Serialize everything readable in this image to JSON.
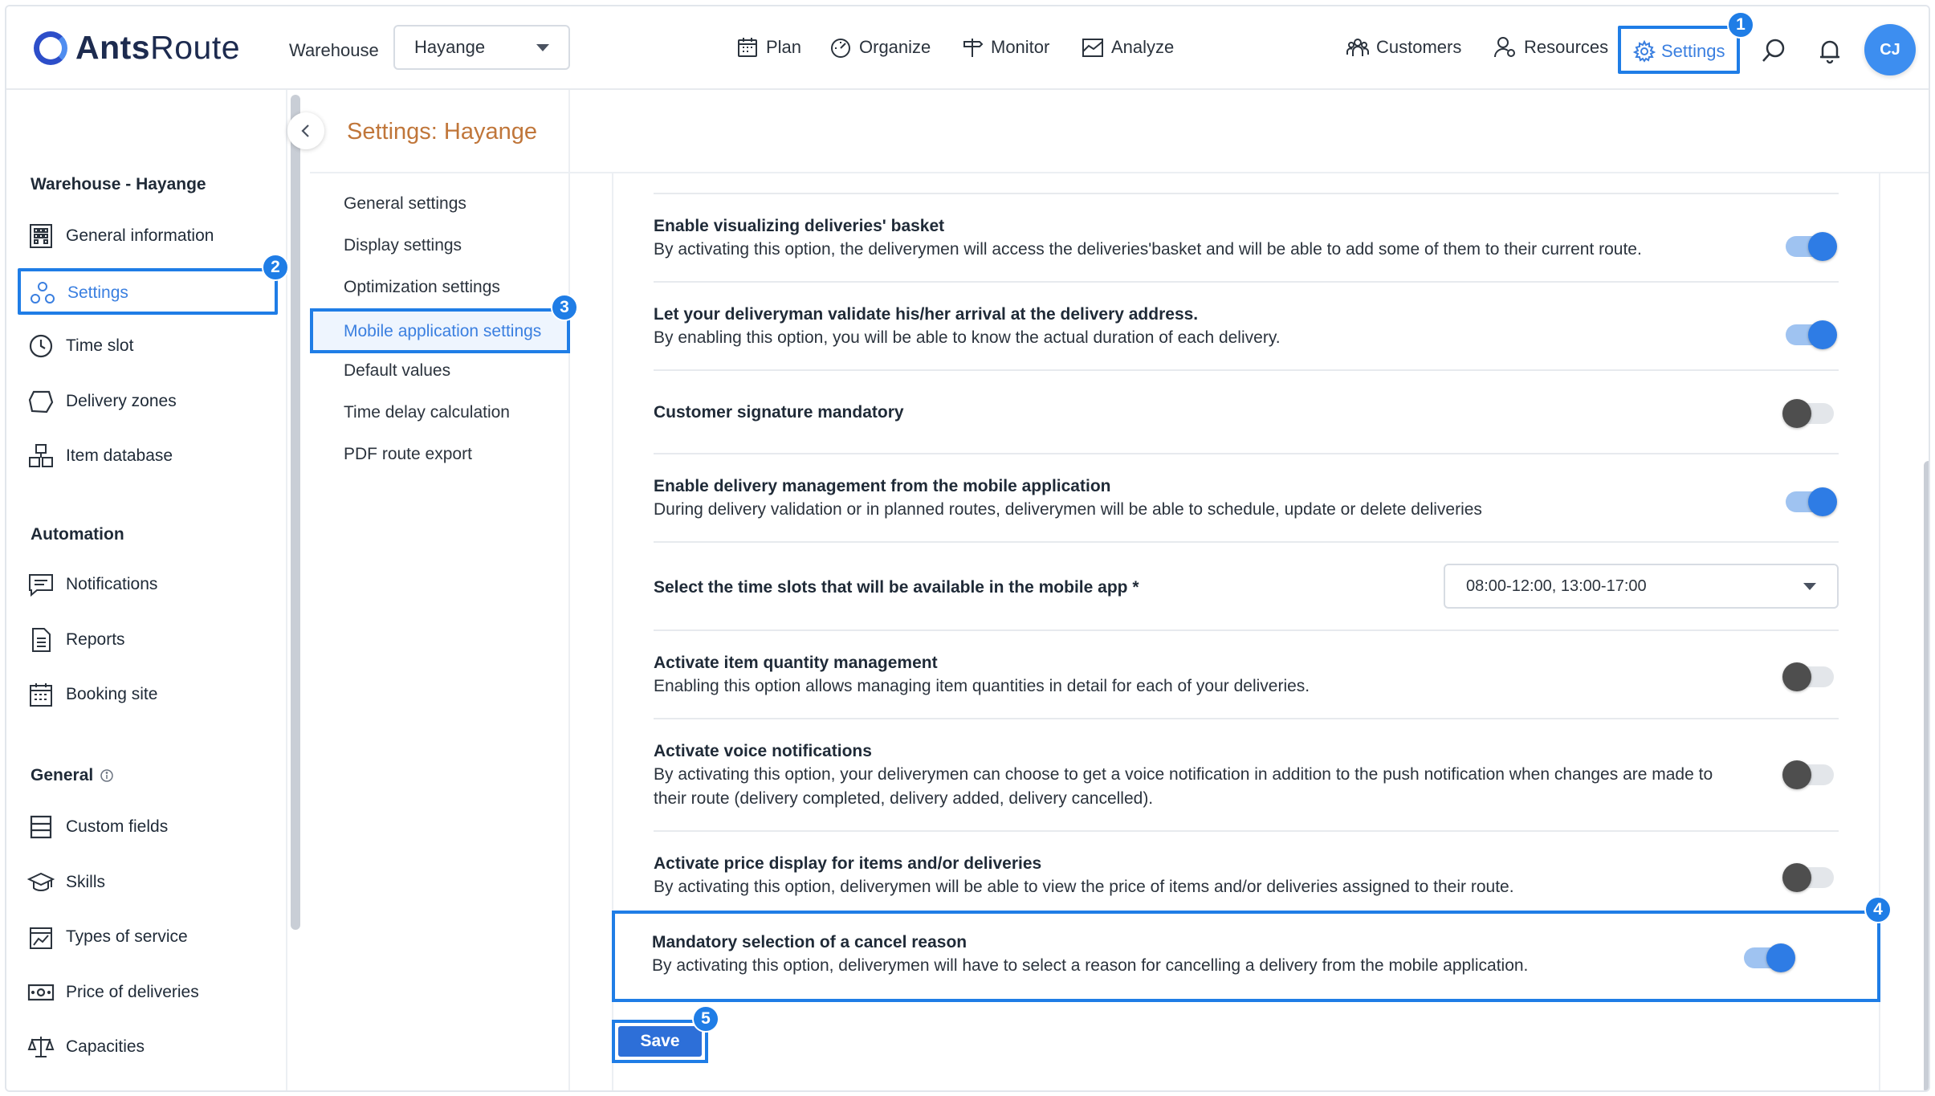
{
  "app": {
    "logo_text_bold": "Ants",
    "logo_text_rest": "Route"
  },
  "header": {
    "warehouse_label": "Warehouse",
    "warehouse_value": "Hayange",
    "nav": [
      {
        "label": "Plan",
        "icon": "calendar-icon"
      },
      {
        "label": "Organize",
        "icon": "gauge-icon"
      },
      {
        "label": "Monitor",
        "icon": "signpost-icon"
      },
      {
        "label": "Analyze",
        "icon": "chart-icon"
      },
      {
        "label": "Customers",
        "icon": "customers-icon"
      },
      {
        "label": "Resources",
        "icon": "resources-icon"
      },
      {
        "label": "Settings",
        "icon": "gear-icon"
      }
    ],
    "avatar_initials": "CJ"
  },
  "badges": [
    "1",
    "2",
    "3",
    "4",
    "5"
  ],
  "sidebar": {
    "section_warehouse": "Warehouse - Hayange",
    "warehouse_items": [
      {
        "label": "General information",
        "icon": "building-icon"
      },
      {
        "label": "Settings",
        "icon": "settings-nodes-icon"
      },
      {
        "label": "Time slot",
        "icon": "clock-icon"
      },
      {
        "label": "Delivery zones",
        "icon": "zone-icon"
      },
      {
        "label": "Item database",
        "icon": "boxes-icon"
      }
    ],
    "section_automation": "Automation",
    "automation_items": [
      {
        "label": "Notifications",
        "icon": "message-icon"
      },
      {
        "label": "Reports",
        "icon": "report-icon"
      },
      {
        "label": "Booking site",
        "icon": "booking-icon"
      }
    ],
    "section_general": "General",
    "general_items": [
      {
        "label": "Custom fields",
        "icon": "fields-icon"
      },
      {
        "label": "Skills",
        "icon": "graduation-icon"
      },
      {
        "label": "Types of service",
        "icon": "service-icon"
      },
      {
        "label": "Price of deliveries",
        "icon": "price-icon"
      },
      {
        "label": "Capacities",
        "icon": "scale-icon"
      }
    ]
  },
  "page": {
    "title": "Settings: Hayange"
  },
  "submenu": [
    "General settings",
    "Display settings",
    "Optimization settings",
    "Mobile application settings",
    "Default values",
    "Time delay calculation",
    "PDF route export"
  ],
  "settings": [
    {
      "title": "Enable visualizing deliveries' basket",
      "desc": "By activating this option, the deliverymen will access the deliveries'basket and will be able to add some of them to their current route.",
      "on": true
    },
    {
      "title": "Let your deliveryman validate his/her arrival at the delivery address.",
      "desc": "By enabling this option, you will be able to know the actual duration of each delivery.",
      "on": true
    },
    {
      "title": "Customer signature mandatory",
      "desc": "",
      "on": false
    },
    {
      "title": "Enable delivery management from the mobile application",
      "desc": "During delivery validation or in planned routes, deliverymen will be able to schedule, update or delete deliveries",
      "on": true
    },
    {
      "title": "Select the time slots that will be available in the mobile app *",
      "select_value": "08:00-12:00, 13:00-17:00"
    },
    {
      "title": "Activate item quantity management",
      "desc": "Enabling this option allows managing item quantities in detail for each of your deliveries.",
      "on": false
    },
    {
      "title": "Activate voice notifications",
      "desc": "By activating this option, your deliverymen can choose to get a voice notification in addition to the push notification when changes are made to their route (delivery completed, delivery added, delivery cancelled).",
      "on": false
    },
    {
      "title": "Activate price display for items and/or deliveries",
      "desc": "By activating this option, deliverymen will be able to view the price of items and/or deliveries assigned to their route.",
      "on": false
    },
    {
      "title": "Mandatory selection of a cancel reason",
      "desc": "By activating this option, deliverymen will have to select a reason for cancelling a delivery from the mobile application.",
      "on": true
    }
  ],
  "save_label": "Save",
  "colors": {
    "accent": "#1f7de6",
    "title_orange": "#c0763a",
    "toggle_on": "#2e7ce5"
  }
}
